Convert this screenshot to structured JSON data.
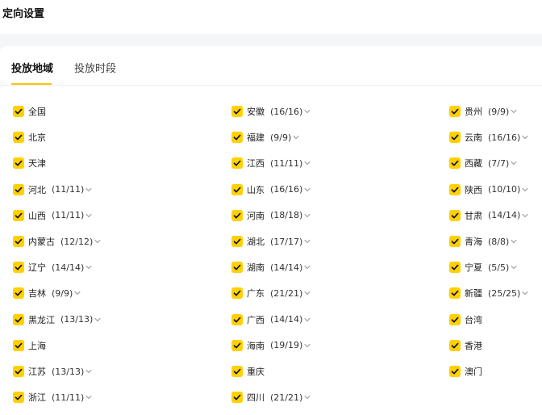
{
  "header": {
    "title": "定向设置"
  },
  "tabs": [
    {
      "label": "投放地域",
      "active": true
    },
    {
      "label": "投放时段",
      "active": false
    }
  ],
  "accent_color": "#ffd100",
  "columns": [
    [
      {
        "label": "全国",
        "count": "",
        "expandable": false,
        "checked": true
      },
      {
        "label": "北京",
        "count": "",
        "expandable": false,
        "checked": true
      },
      {
        "label": "天津",
        "count": "",
        "expandable": false,
        "checked": true
      },
      {
        "label": "河北",
        "count": "(11/11)",
        "expandable": true,
        "checked": true
      },
      {
        "label": "山西",
        "count": "(11/11)",
        "expandable": true,
        "checked": true
      },
      {
        "label": "内蒙古",
        "count": "(12/12)",
        "expandable": true,
        "checked": true
      },
      {
        "label": "辽宁",
        "count": "(14/14)",
        "expandable": true,
        "checked": true
      },
      {
        "label": "吉林",
        "count": "(9/9)",
        "expandable": true,
        "checked": true
      },
      {
        "label": "黑龙江",
        "count": "(13/13)",
        "expandable": true,
        "checked": true
      },
      {
        "label": "上海",
        "count": "",
        "expandable": false,
        "checked": true
      },
      {
        "label": "江苏",
        "count": "(13/13)",
        "expandable": true,
        "checked": true
      },
      {
        "label": "浙江",
        "count": "(11/11)",
        "expandable": true,
        "checked": true
      }
    ],
    [
      {
        "label": "安徽",
        "count": "(16/16)",
        "expandable": true,
        "checked": true
      },
      {
        "label": "福建",
        "count": "(9/9)",
        "expandable": true,
        "checked": true
      },
      {
        "label": "江西",
        "count": "(11/11)",
        "expandable": true,
        "checked": true
      },
      {
        "label": "山东",
        "count": "(16/16)",
        "expandable": true,
        "checked": true
      },
      {
        "label": "河南",
        "count": "(18/18)",
        "expandable": true,
        "checked": true
      },
      {
        "label": "湖北",
        "count": "(17/17)",
        "expandable": true,
        "checked": true
      },
      {
        "label": "湖南",
        "count": "(14/14)",
        "expandable": true,
        "checked": true
      },
      {
        "label": "广东",
        "count": "(21/21)",
        "expandable": true,
        "checked": true
      },
      {
        "label": "广西",
        "count": "(14/14)",
        "expandable": true,
        "checked": true
      },
      {
        "label": "海南",
        "count": "(19/19)",
        "expandable": true,
        "checked": true
      },
      {
        "label": "重庆",
        "count": "",
        "expandable": false,
        "checked": true
      },
      {
        "label": "四川",
        "count": "(21/21)",
        "expandable": true,
        "checked": true
      }
    ],
    [
      {
        "label": "贵州",
        "count": "(9/9)",
        "expandable": true,
        "checked": true
      },
      {
        "label": "云南",
        "count": "(16/16)",
        "expandable": true,
        "checked": true
      },
      {
        "label": "西藏",
        "count": "(7/7)",
        "expandable": true,
        "checked": true
      },
      {
        "label": "陕西",
        "count": "(10/10)",
        "expandable": true,
        "checked": true
      },
      {
        "label": "甘肃",
        "count": "(14/14)",
        "expandable": true,
        "checked": true
      },
      {
        "label": "青海",
        "count": "(8/8)",
        "expandable": true,
        "checked": true
      },
      {
        "label": "宁夏",
        "count": "(5/5)",
        "expandable": true,
        "checked": true
      },
      {
        "label": "新疆",
        "count": "(25/25)",
        "expandable": true,
        "checked": true
      },
      {
        "label": "台湾",
        "count": "",
        "expandable": false,
        "checked": true
      },
      {
        "label": "香港",
        "count": "",
        "expandable": false,
        "checked": true
      },
      {
        "label": "澳门",
        "count": "",
        "expandable": false,
        "checked": true
      }
    ]
  ]
}
